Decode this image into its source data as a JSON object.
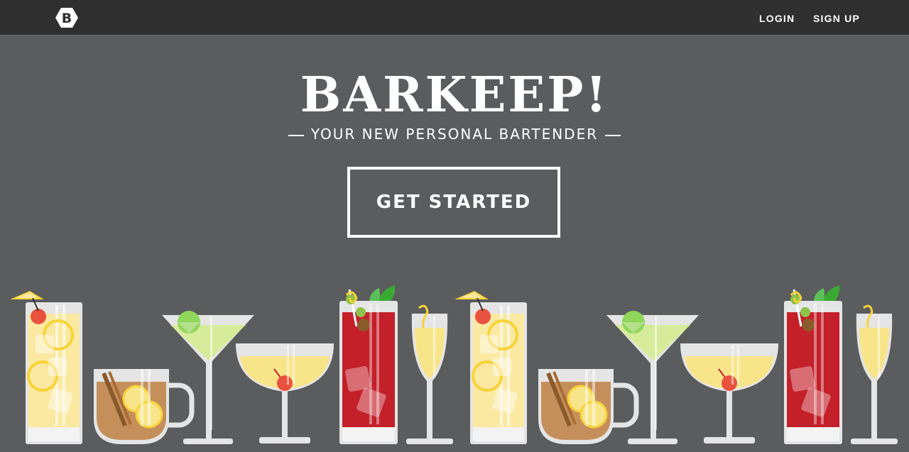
{
  "nav": {
    "logo_letter": "B",
    "login": "LOGIN",
    "signup": "SIGN UP"
  },
  "hero": {
    "title": "BARKEEP!",
    "subtitle": "YOUR NEW PERSONAL BARTENDER",
    "cta": "GET STARTED"
  },
  "colors": {
    "background": "#5b5c5e",
    "navbar": "#2f2f2f",
    "text": "#ffffff",
    "lemonade": "#fbe9a1",
    "tea": "#c58f5c",
    "martini": "#d6ec9a",
    "champagne_coupe": "#f9e589",
    "red_drink": "#c3202a",
    "cherry": "#e8523f",
    "glass": "#e5e5e5"
  },
  "illustration": {
    "drinks": [
      "lemonade-glass",
      "hot-toddy-mug",
      "martini-glass",
      "coupe-glass",
      "red-highball-glass",
      "champagne-flute",
      "lemonade-glass",
      "hot-toddy-mug",
      "martini-glass",
      "coupe-glass",
      "red-highball-glass",
      "champagne-flute"
    ]
  }
}
